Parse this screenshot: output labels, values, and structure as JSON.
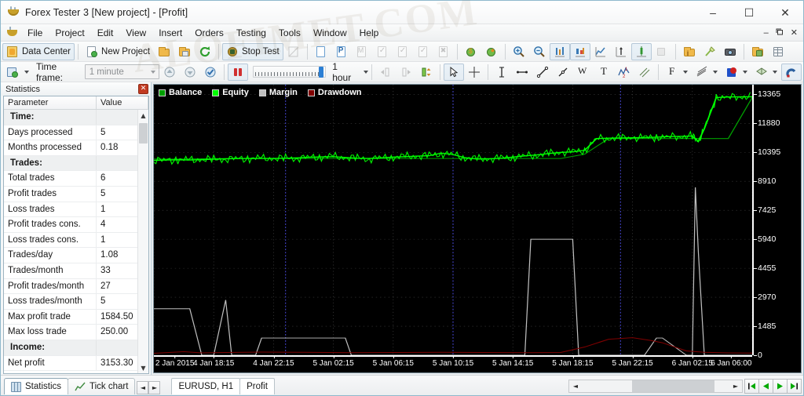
{
  "window": {
    "title": "Forex Tester 3  [New project] - [Profit]",
    "app_icon": "coffee-cup-icon",
    "minimize": "–",
    "maximize": "☐",
    "close": "✕",
    "mdi_minimize": "–",
    "mdi_restore": "❐",
    "mdi_close": "✕"
  },
  "menu": {
    "items": [
      "File",
      "Project",
      "Edit",
      "View",
      "Insert",
      "Orders",
      "Testing",
      "Tools",
      "Window",
      "Help"
    ]
  },
  "toolbar1": {
    "data_center": "Data Center",
    "new_project": "New Project",
    "stop_test": "Stop Test"
  },
  "toolbar2": {
    "time_frame_label": "Time frame:",
    "time_frame_value": "1 minute",
    "speed_value": "1 hour"
  },
  "statistics": {
    "panel_title": "Statistics",
    "close_glyph": "✕",
    "col_parameter": "Parameter",
    "col_value": "Value",
    "rows": [
      {
        "group": true,
        "parameter": "Time:",
        "value": ""
      },
      {
        "group": false,
        "parameter": "Days processed",
        "value": "5"
      },
      {
        "group": false,
        "parameter": "Months processed",
        "value": "0.18"
      },
      {
        "group": true,
        "parameter": "Trades:",
        "value": ""
      },
      {
        "group": false,
        "parameter": "Total trades",
        "value": "6"
      },
      {
        "group": false,
        "parameter": "Profit trades",
        "value": "5"
      },
      {
        "group": false,
        "parameter": "Loss trades",
        "value": "1"
      },
      {
        "group": false,
        "parameter": "Profit trades cons.",
        "value": "4"
      },
      {
        "group": false,
        "parameter": "Loss trades cons.",
        "value": "1"
      },
      {
        "group": false,
        "parameter": "Trades/day",
        "value": "1.08"
      },
      {
        "group": false,
        "parameter": "Trades/month",
        "value": "33"
      },
      {
        "group": false,
        "parameter": "Profit trades/month",
        "value": "27"
      },
      {
        "group": false,
        "parameter": "Loss trades/month",
        "value": "5"
      },
      {
        "group": false,
        "parameter": "Max profit trade",
        "value": "1584.50"
      },
      {
        "group": false,
        "parameter": "Max loss trade",
        "value": "250.00"
      },
      {
        "group": true,
        "parameter": "Income:",
        "value": ""
      },
      {
        "group": false,
        "parameter": "Net profit",
        "value": "3153.30"
      }
    ],
    "scroll_up": "▲",
    "scroll_down": "▼"
  },
  "chart_data": {
    "type": "line",
    "title": "Profit",
    "background": "#000000",
    "grid": true,
    "legend_position": "top-left",
    "xlabel": "",
    "ylabel": "",
    "legend": [
      {
        "name": "Balance",
        "color": "#00a000"
      },
      {
        "name": "Equity",
        "color": "#00ff00"
      },
      {
        "name": "Margin",
        "color": "#c0c0c0"
      },
      {
        "name": "Drawdown",
        "color": "#800000"
      }
    ],
    "ylim": [
      0,
      13860
    ],
    "yticks": [
      0,
      1485,
      2970,
      4455,
      5940,
      7425,
      8910,
      10395,
      11880,
      13365
    ],
    "xticks": [
      "2 Jan 2015",
      "4 Jan 18:15",
      "4 Jan 22:15",
      "5 Jan 02:15",
      "5 Jan 06:15",
      "5 Jan 10:15",
      "5 Jan 14:15",
      "5 Jan 18:15",
      "5 Jan 22:15",
      "6 Jan 02:15",
      "6 Jan 06:00"
    ],
    "series": [
      {
        "name": "Balance",
        "color": "#00a000",
        "x": [
          0,
          5,
          12,
          20,
          28,
          36,
          44,
          52,
          58,
          62,
          68,
          72,
          76,
          80,
          86,
          92,
          96,
          100
        ],
        "values": [
          10050,
          10050,
          10080,
          10080,
          10080,
          10080,
          10080,
          10080,
          10080,
          10080,
          10080,
          10300,
          11100,
          11100,
          11100,
          11100,
          11100,
          13200
        ]
      },
      {
        "name": "Equity",
        "color": "#00ff00",
        "x": [
          0,
          2,
          4,
          6,
          8,
          10,
          12,
          14,
          16,
          18,
          20,
          22,
          24,
          26,
          28,
          30,
          32,
          34,
          36,
          38,
          40,
          42,
          44,
          46,
          48,
          50,
          52,
          54,
          56,
          58,
          60,
          62,
          64,
          66,
          68,
          70,
          72,
          74,
          76,
          78,
          80,
          82,
          84,
          86,
          88,
          90,
          91,
          92,
          94,
          96,
          98,
          100
        ],
        "values": [
          9980,
          10000,
          10010,
          10000,
          10020,
          10040,
          10060,
          10075,
          10080,
          10080,
          10080,
          10090,
          10110,
          10140,
          10160,
          10170,
          10130,
          10090,
          10080,
          10110,
          10150,
          10170,
          10200,
          10220,
          10350,
          10280,
          10120,
          10050,
          10060,
          10090,
          10150,
          10210,
          10260,
          10330,
          10390,
          10420,
          10500,
          11100,
          11120,
          11130,
          11140,
          11150,
          11170,
          11200,
          11210,
          11230,
          10950,
          11600,
          13200,
          13230,
          13240,
          13240
        ]
      },
      {
        "name": "Margin",
        "color": "#c0c0c0",
        "x": [
          0,
          6,
          8,
          10,
          12,
          13,
          17,
          18,
          32,
          33,
          36,
          37,
          62,
          63,
          70,
          71,
          80,
          82,
          84,
          85,
          89,
          90,
          90.5,
          91,
          92,
          93,
          100
        ],
        "values": [
          2380,
          2380,
          0,
          0,
          2830,
          0,
          0,
          880,
          880,
          0,
          0,
          0,
          0,
          5940,
          5940,
          0,
          0,
          0,
          880,
          880,
          0,
          0,
          8600,
          5300,
          0,
          0,
          0
        ]
      },
      {
        "name": "Drawdown",
        "color": "#800000",
        "x": [
          0,
          5,
          8,
          12,
          18,
          25,
          33,
          40,
          48,
          55,
          62,
          68,
          72,
          76,
          80,
          83,
          85,
          87,
          89,
          92,
          96,
          100
        ],
        "values": [
          100,
          180,
          120,
          140,
          160,
          150,
          130,
          140,
          150,
          140,
          130,
          140,
          420,
          820,
          900,
          760,
          640,
          430,
          220,
          150,
          120,
          110
        ]
      }
    ]
  },
  "bottom": {
    "tab_statistics": "Statistics",
    "tab_tick_chart": "Tick chart",
    "nav_prev": "◄",
    "nav_next": "►",
    "doc_tab_symbol": "EURUSD, H1",
    "doc_tab_profit": "Profit",
    "hscroll_left": "◄",
    "hscroll_right": "►"
  },
  "watermark": "ALOFIMET.COM"
}
